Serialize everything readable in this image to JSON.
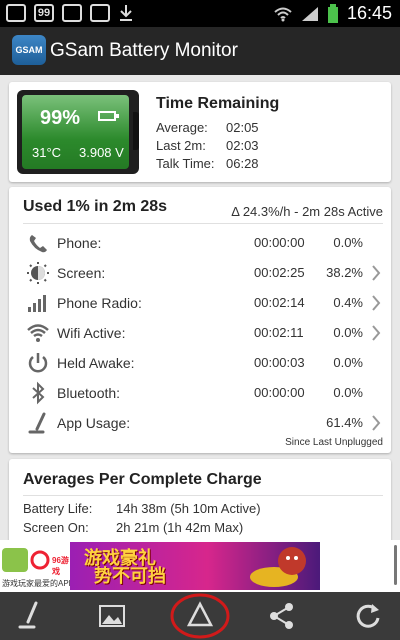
{
  "status_bar": {
    "badge": "99",
    "time": "16:45"
  },
  "app": {
    "title": "GSam Battery Monitor",
    "logo_text": "GSAM"
  },
  "battery": {
    "percent": "99%",
    "temperature": "31°C",
    "voltage": "3.908 V",
    "level": 0.99,
    "color": "#2c8a2c"
  },
  "time_remaining": {
    "title": "Time Remaining",
    "rows": [
      {
        "label": "Average:",
        "value": "02:05"
      },
      {
        "label": "Last 2m:",
        "value": "02:03"
      },
      {
        "label": "Talk Time:",
        "value": "06:28"
      }
    ]
  },
  "usage": {
    "title": "Used 1% in 2m 28s",
    "rate": "Δ 24.3%/h - 2m 28s Active",
    "rows": [
      {
        "icon": "phone-icon",
        "label": "Phone:",
        "time": "00:00:00",
        "percent": "0.0%",
        "has_chevron": false
      },
      {
        "icon": "screen-icon",
        "label": "Screen:",
        "time": "00:02:25",
        "percent": "38.2%",
        "has_chevron": true
      },
      {
        "icon": "signal-icon",
        "label": "Phone Radio:",
        "time": "00:02:14",
        "percent": "0.4%",
        "has_chevron": true
      },
      {
        "icon": "wifi-icon",
        "label": "Wifi Active:",
        "time": "00:02:11",
        "percent": "0.0%",
        "has_chevron": true
      },
      {
        "icon": "power-icon",
        "label": "Held Awake:",
        "time": "00:00:03",
        "percent": "0.0%",
        "has_chevron": false
      },
      {
        "icon": "bluetooth-icon",
        "label": "Bluetooth:",
        "time": "00:00:00",
        "percent": "0.0%",
        "has_chevron": false
      },
      {
        "icon": "app-usage-icon",
        "label": "App Usage:",
        "time": "",
        "percent": "61.4%",
        "has_chevron": true
      }
    ],
    "footer": "Since Last Unplugged"
  },
  "averages": {
    "title": "Averages Per Complete Charge",
    "rows": [
      {
        "label": "Battery Life:",
        "value": "14h 38m (5h 10m Active)"
      },
      {
        "label": "Screen On:",
        "value": "2h 21m (1h 42m Max)"
      }
    ]
  },
  "ad": {
    "logo_text": "96游戏",
    "caption": "游戏玩家最爱的APP",
    "banner_text_line1": "游戏豪礼",
    "banner_text_line2": "势不可挡"
  },
  "bottom_bar": {
    "buttons": [
      "app-usage-icon",
      "image-icon",
      "delta-icon",
      "share-icon",
      "refresh-icon"
    ]
  },
  "colors": {
    "accent_battery": "#2c8a2c",
    "highlight_circle": "#d11a1a"
  }
}
